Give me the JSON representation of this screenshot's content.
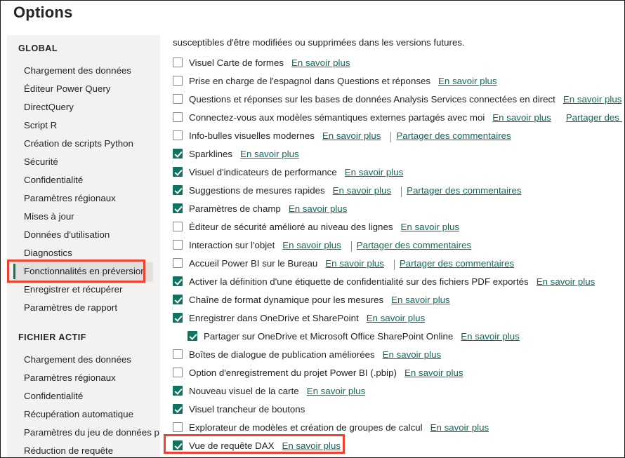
{
  "window": {
    "title": "Options"
  },
  "sidebar": {
    "groups": [
      {
        "title": "GLOBAL",
        "items": [
          {
            "label": "Chargement des données",
            "selected": false
          },
          {
            "label": "Éditeur Power Query",
            "selected": false
          },
          {
            "label": "DirectQuery",
            "selected": false
          },
          {
            "label": "Script R",
            "selected": false
          },
          {
            "label": "Création de scripts Python",
            "selected": false
          },
          {
            "label": "Sécurité",
            "selected": false
          },
          {
            "label": "Confidentialité",
            "selected": false
          },
          {
            "label": "Paramètres régionaux",
            "selected": false
          },
          {
            "label": "Mises à jour",
            "selected": false
          },
          {
            "label": "Données d'utilisation",
            "selected": false
          },
          {
            "label": "Diagnostics",
            "selected": false
          },
          {
            "label": "Fonctionnalités en préversion",
            "selected": true
          },
          {
            "label": "Enregistrer et récupérer",
            "selected": false
          },
          {
            "label": "Paramètres de rapport",
            "selected": false
          }
        ]
      },
      {
        "title": "FICHIER ACTIF",
        "items": [
          {
            "label": "Chargement des données",
            "selected": false
          },
          {
            "label": "Paramètres régionaux",
            "selected": false
          },
          {
            "label": "Confidentialité",
            "selected": false
          },
          {
            "label": "Récupération automatique",
            "selected": false
          },
          {
            "label": "Paramètres du jeu de données p...",
            "selected": false
          },
          {
            "label": "Réduction de requête",
            "selected": false
          }
        ]
      }
    ]
  },
  "main": {
    "intro": "susceptibles d'être modifiées ou supprimées dans les versions futures.",
    "learn_more_label": "En savoir plus",
    "share_feedback_label": "Partager des commentaires",
    "options": [
      {
        "label": "Visuel Carte de formes",
        "checked": false,
        "indented": false,
        "learn_more": true,
        "feedback": false
      },
      {
        "label": "Prise en charge de l'espagnol dans Questions et réponses",
        "checked": false,
        "indented": false,
        "learn_more": true,
        "feedback": false
      },
      {
        "label": "Questions et réponses sur les bases de données Analysis Services connectées en direct",
        "checked": false,
        "indented": false,
        "learn_more": true,
        "feedback": false
      },
      {
        "label": "Connectez-vous aux modèles sémantiques externes partagés avec moi",
        "checked": false,
        "indented": false,
        "learn_more": true,
        "feedback": true
      },
      {
        "label": "Info-bulles visuelles modernes",
        "checked": false,
        "indented": false,
        "learn_more": true,
        "feedback": true
      },
      {
        "label": "Sparklines",
        "checked": true,
        "indented": false,
        "learn_more": true,
        "feedback": false
      },
      {
        "label": "Visuel d'indicateurs de performance",
        "checked": true,
        "indented": false,
        "learn_more": true,
        "feedback": false
      },
      {
        "label": "Suggestions de mesures rapides",
        "checked": true,
        "indented": false,
        "learn_more": true,
        "feedback": true
      },
      {
        "label": "Paramètres de champ",
        "checked": true,
        "indented": false,
        "learn_more": true,
        "feedback": false
      },
      {
        "label": "Éditeur de sécurité amélioré au niveau des lignes",
        "checked": false,
        "indented": false,
        "learn_more": true,
        "feedback": false
      },
      {
        "label": "Interaction sur l'objet",
        "checked": false,
        "indented": false,
        "learn_more": true,
        "feedback": true
      },
      {
        "label": "Accueil Power BI sur le Bureau",
        "checked": false,
        "indented": false,
        "learn_more": true,
        "feedback": true
      },
      {
        "label": "Activer la définition d'une étiquette de confidentialité sur des fichiers PDF exportés",
        "checked": true,
        "indented": false,
        "learn_more": true,
        "feedback": false
      },
      {
        "label": "Chaîne de format dynamique pour les mesures",
        "checked": true,
        "indented": false,
        "learn_more": true,
        "feedback": false
      },
      {
        "label": "Enregistrer dans OneDrive et SharePoint",
        "checked": true,
        "indented": false,
        "learn_more": true,
        "feedback": false
      },
      {
        "label": "Partager sur OneDrive et Microsoft Office SharePoint Online",
        "checked": true,
        "indented": true,
        "learn_more": true,
        "feedback": false
      },
      {
        "label": "Boîtes de dialogue de publication améliorées",
        "checked": false,
        "indented": false,
        "learn_more": true,
        "feedback": false
      },
      {
        "label": "Option d'enregistrement du projet Power BI (.pbip)",
        "checked": false,
        "indented": false,
        "learn_more": true,
        "feedback": false
      },
      {
        "label": "Nouveau visuel de la carte",
        "checked": true,
        "indented": false,
        "learn_more": true,
        "feedback": false
      },
      {
        "label": "Visuel trancheur de boutons",
        "checked": true,
        "indented": false,
        "learn_more": false,
        "feedback": false
      },
      {
        "label": "Explorateur de modèles et création de groupes de calcul",
        "checked": false,
        "indented": false,
        "learn_more": true,
        "feedback": false
      },
      {
        "label": "Vue de requête DAX",
        "checked": true,
        "indented": false,
        "learn_more": true,
        "feedback": false
      }
    ]
  },
  "annotations": {
    "highlight_color": "#f0412f",
    "accent_color": "#0f7362",
    "link_color": "#0f6a5a"
  }
}
